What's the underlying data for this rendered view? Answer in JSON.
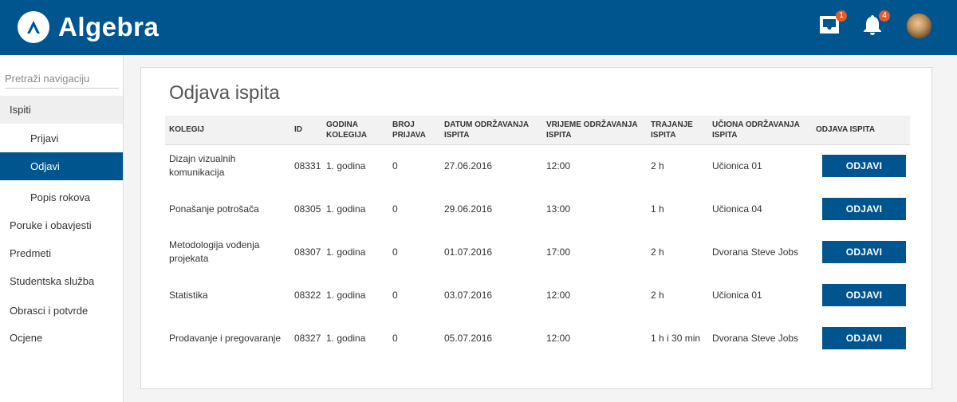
{
  "header": {
    "logo_text": "Algebra",
    "inbox_badge": "1",
    "notifications_badge": "4"
  },
  "colors": {
    "brand": "#00558f",
    "badge": "#e55a2b"
  },
  "sidebar": {
    "search_placeholder": "Pretraži navigaciju",
    "items": [
      {
        "label": "Ispiti"
      },
      {
        "label": "Prijavi"
      },
      {
        "label": "Odjavi"
      },
      {
        "label": "Popis rokova"
      },
      {
        "label": "Poruke i obavjesti"
      },
      {
        "label": "Predmeti"
      },
      {
        "label": "Studentska služba"
      },
      {
        "label": "Obrasci i potvrde"
      },
      {
        "label": "Ocjene"
      }
    ]
  },
  "main": {
    "title": "Odjava ispita",
    "columns": [
      "KOLEGIJ",
      "ID",
      "GODINA KOLEGIJA",
      "BROJ PRIJAVA",
      "DATUM ODRŽAVANJA ISPITA",
      "VRIJEME ODRŽAVANJA ISPITA",
      "TRAJANJE ISPITA",
      "UČIONA ODRŽAVANJA ISPITA",
      "ODJAVA ISPITA"
    ],
    "rows": [
      {
        "kolegij": "Dizajn vizualnih komunikacija",
        "id": "08331",
        "godina": "1. godina",
        "broj": "0",
        "datum": "27.06.2016",
        "vrijeme": "12:00",
        "trajanje": "2 h",
        "uciona": "Učionica 01",
        "action": "ODJAVI"
      },
      {
        "kolegij": "Ponašanje potrošača",
        "id": "08305",
        "godina": "1. godina",
        "broj": "0",
        "datum": "29.06.2016",
        "vrijeme": "13:00",
        "trajanje": "1 h",
        "uciona": "Učionica 04",
        "action": "ODJAVI"
      },
      {
        "kolegij": "Metodologija vođenja projekata",
        "id": "08307",
        "godina": "1. godina",
        "broj": "0",
        "datum": "01.07.2016",
        "vrijeme": "17:00",
        "trajanje": "2 h",
        "uciona": "Dvorana Steve Jobs",
        "action": "ODJAVI"
      },
      {
        "kolegij": "Statistika",
        "id": "08322",
        "godina": "1. godina",
        "broj": "0",
        "datum": "03.07.2016",
        "vrijeme": "12:00",
        "trajanje": "2 h",
        "uciona": "Učionica 01",
        "action": "ODJAVI"
      },
      {
        "kolegij": "Prodavanje i pregovaranje",
        "id": "08327",
        "godina": "1. godina",
        "broj": "0",
        "datum": "05.07.2016",
        "vrijeme": "12:00",
        "trajanje": "1 h i 30 min",
        "uciona": "Dvorana Steve Jobs",
        "action": "ODJAVI"
      }
    ]
  },
  "icons": {
    "logo": "algebra-logo-icon",
    "inbox": "inbox-icon",
    "notifications": "bell-icon",
    "avatar": "user-avatar"
  }
}
